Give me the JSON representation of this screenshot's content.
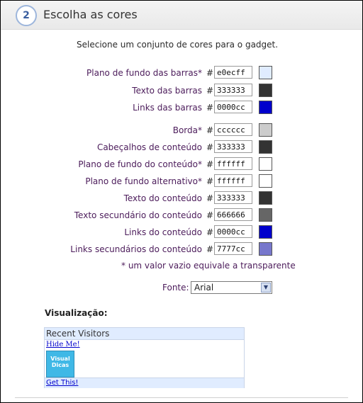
{
  "section": {
    "step": "2",
    "title": "Escolha as cores"
  },
  "intro": "Selecione um conjunto de cores para o gadget.",
  "groups": {
    "bars": [
      {
        "label": "Plano de fundo das barras*",
        "value": "e0ecff",
        "color": "#e0ecff"
      },
      {
        "label": "Texto das barras",
        "value": "333333",
        "color": "#333333"
      },
      {
        "label": "Links das barras",
        "value": "0000cc",
        "color": "#0000cc"
      }
    ],
    "content": [
      {
        "label": "Borda*",
        "value": "cccccc",
        "color": "#cccccc"
      },
      {
        "label": "Cabeçalhos de conteúdo",
        "value": "333333",
        "color": "#333333"
      },
      {
        "label": "Plano de fundo do conteúdo*",
        "value": "ffffff",
        "color": "#ffffff"
      },
      {
        "label": "Plano de fundo alternativo*",
        "value": "ffffff",
        "color": "#ffffff"
      },
      {
        "label": "Texto do conteúdo",
        "value": "333333",
        "color": "#333333"
      },
      {
        "label": "Texto secundário do conteúdo",
        "value": "666666",
        "color": "#666666"
      },
      {
        "label": "Links do conteúdo",
        "value": "0000cc",
        "color": "#0000cc"
      },
      {
        "label": "Links secundários do conteúdo",
        "value": "7777cc",
        "color": "#7777cc"
      }
    ]
  },
  "hash": "#",
  "note": "* um valor vazio equivale a transparente",
  "font": {
    "label": "Fonte:",
    "value": "Arial"
  },
  "preview": {
    "title": "Visualização:",
    "bar_title": "Recent Visitors",
    "hide_link": "Hide Me!",
    "logo_text": "Visual Dicas",
    "get_link": "Get This!"
  }
}
